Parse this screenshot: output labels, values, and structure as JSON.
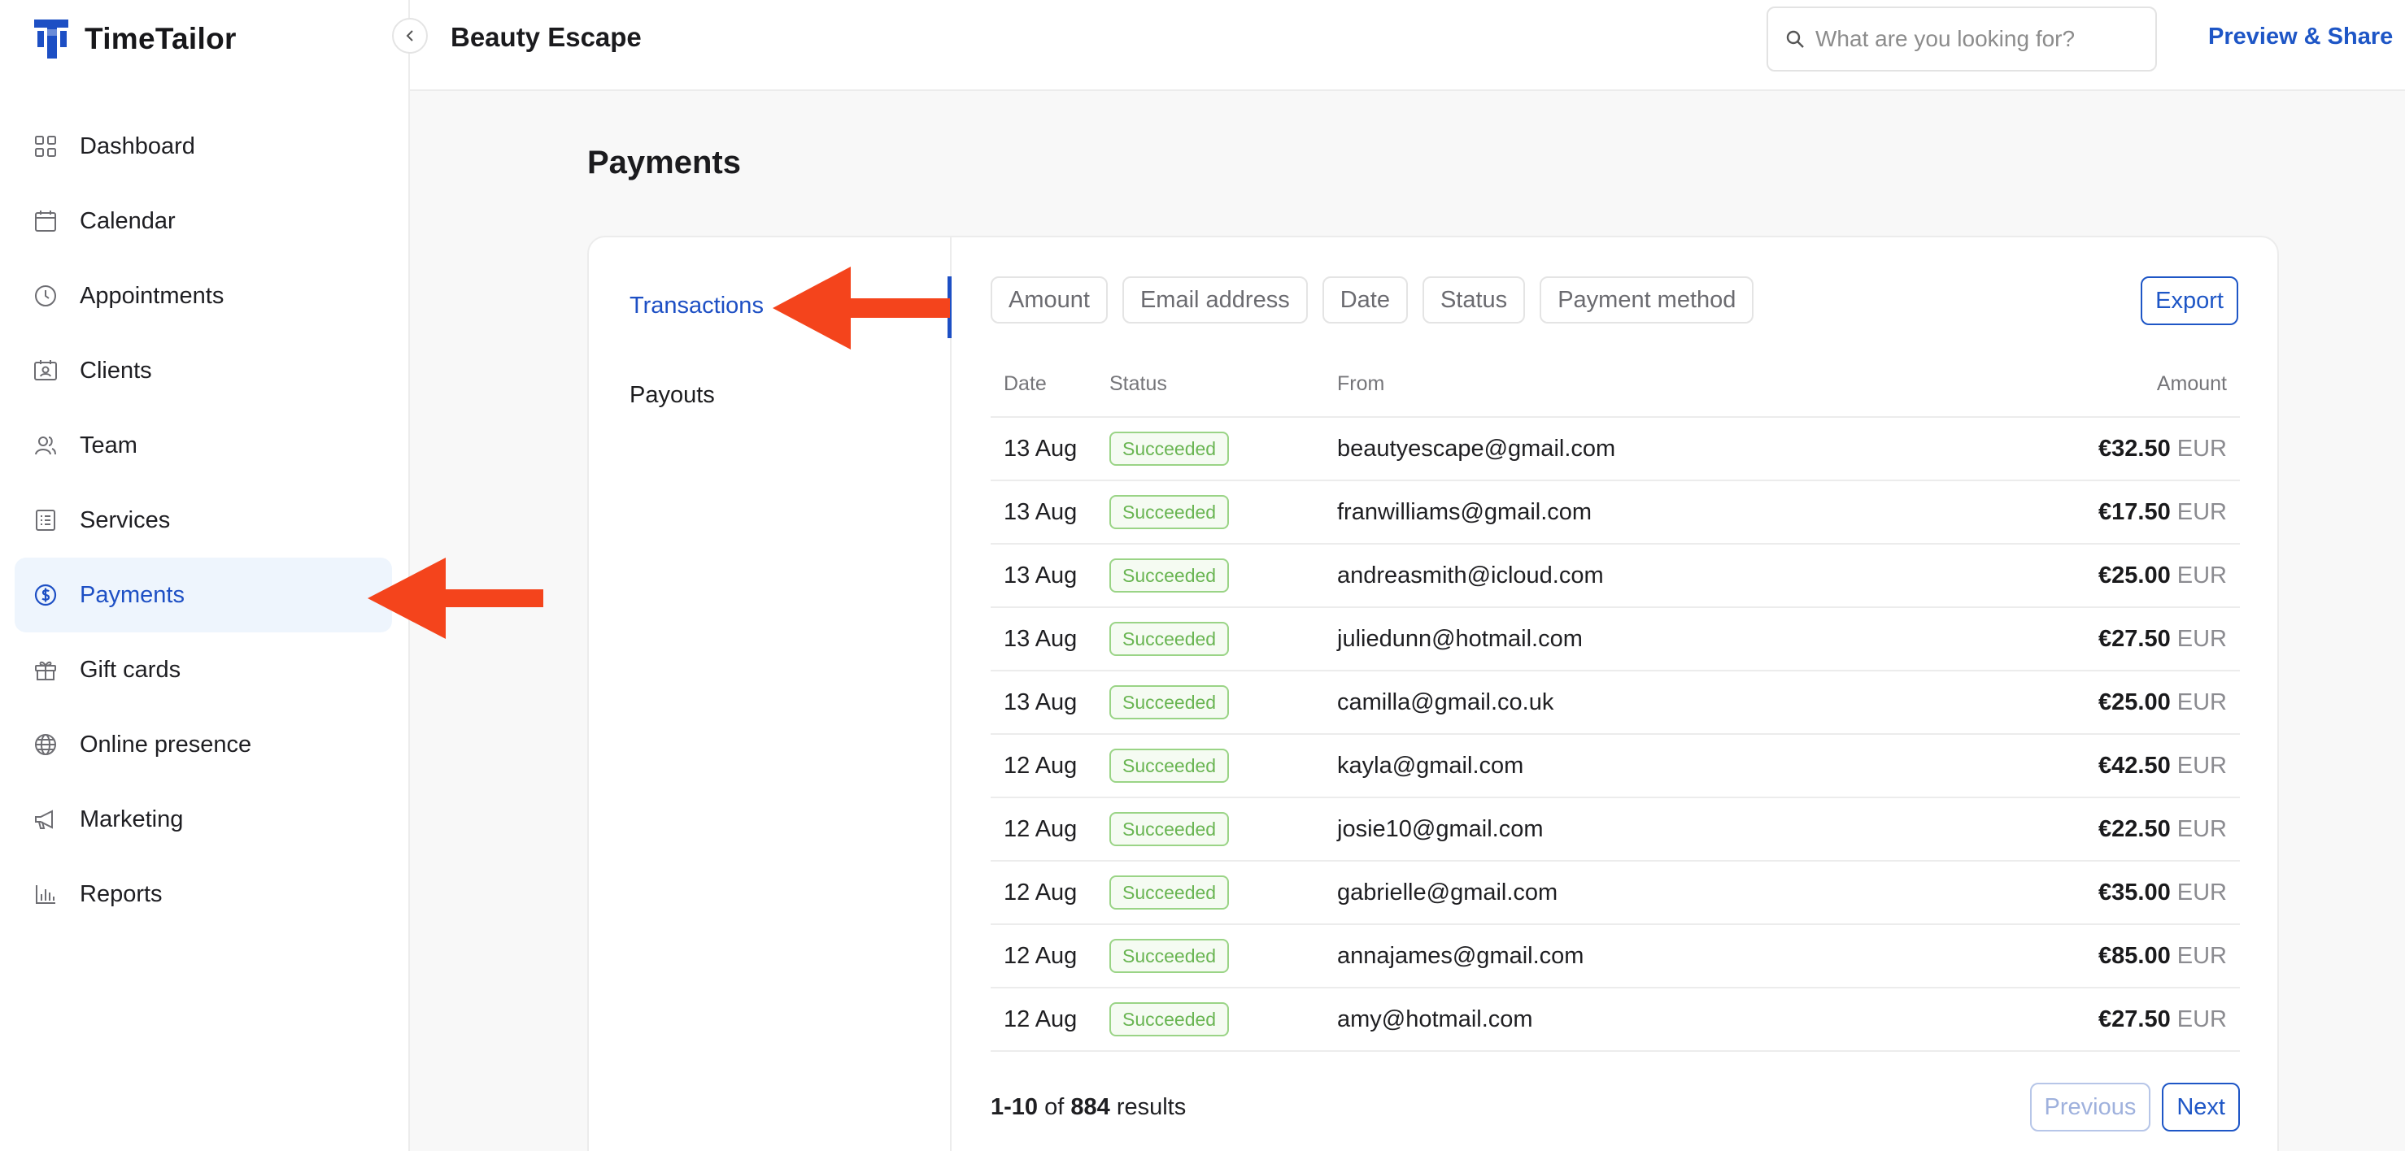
{
  "app": {
    "name": "TimeTailor",
    "brand_color": "#1d4fc4"
  },
  "sidebar": {
    "items": [
      {
        "label": "Dashboard",
        "icon": "dashboard-icon"
      },
      {
        "label": "Calendar",
        "icon": "calendar-icon"
      },
      {
        "label": "Appointments",
        "icon": "clock-icon"
      },
      {
        "label": "Clients",
        "icon": "contact-card-icon"
      },
      {
        "label": "Team",
        "icon": "team-icon"
      },
      {
        "label": "Services",
        "icon": "list-icon"
      },
      {
        "label": "Payments",
        "icon": "dollar-circle-icon",
        "active": true
      },
      {
        "label": "Gift cards",
        "icon": "gift-icon"
      },
      {
        "label": "Online presence",
        "icon": "globe-icon"
      },
      {
        "label": "Marketing",
        "icon": "megaphone-icon"
      },
      {
        "label": "Reports",
        "icon": "bar-chart-icon"
      }
    ]
  },
  "header": {
    "business_name": "Beauty Escape",
    "search_placeholder": "What are you looking for?",
    "preview_share": "Preview & Share"
  },
  "page": {
    "title": "Payments",
    "subnav": [
      {
        "label": "Transactions",
        "active": true
      },
      {
        "label": "Payouts"
      }
    ],
    "filters": [
      "Amount",
      "Email address",
      "Date",
      "Status",
      "Payment method"
    ],
    "export_label": "Export",
    "table": {
      "headers": {
        "date": "Date",
        "status": "Status",
        "from": "From",
        "amount": "Amount"
      },
      "rows": [
        {
          "date": "13 Aug",
          "status": "Succeeded",
          "from": "beautyescape@gmail.com",
          "amount": "€32.50",
          "currency": "EUR"
        },
        {
          "date": "13 Aug",
          "status": "Succeeded",
          "from": "franwilliams@gmail.com",
          "amount": "€17.50",
          "currency": "EUR"
        },
        {
          "date": "13 Aug",
          "status": "Succeeded",
          "from": "andreasmith@icloud.com",
          "amount": "€25.00",
          "currency": "EUR"
        },
        {
          "date": "13 Aug",
          "status": "Succeeded",
          "from": "juliedunn@hotmail.com",
          "amount": "€27.50",
          "currency": "EUR"
        },
        {
          "date": "13 Aug",
          "status": "Succeeded",
          "from": "camilla@gmail.co.uk",
          "amount": "€25.00",
          "currency": "EUR"
        },
        {
          "date": "12 Aug",
          "status": "Succeeded",
          "from": "kayla@gmail.com",
          "amount": "€42.50",
          "currency": "EUR"
        },
        {
          "date": "12 Aug",
          "status": "Succeeded",
          "from": "josie10@gmail.com",
          "amount": "€22.50",
          "currency": "EUR"
        },
        {
          "date": "12 Aug",
          "status": "Succeeded",
          "from": "gabrielle@gmail.com",
          "amount": "€35.00",
          "currency": "EUR"
        },
        {
          "date": "12 Aug",
          "status": "Succeeded",
          "from": "annajames@gmail.com",
          "amount": "€85.00",
          "currency": "EUR"
        },
        {
          "date": "12 Aug",
          "status": "Succeeded",
          "from": "amy@hotmail.com",
          "amount": "€27.50",
          "currency": "EUR"
        }
      ]
    },
    "pagination": {
      "range": "1-10",
      "of_word": "of",
      "total": "884",
      "results_word": "results",
      "previous": "Previous",
      "next": "Next"
    }
  },
  "annotation_color": "#f4441c"
}
